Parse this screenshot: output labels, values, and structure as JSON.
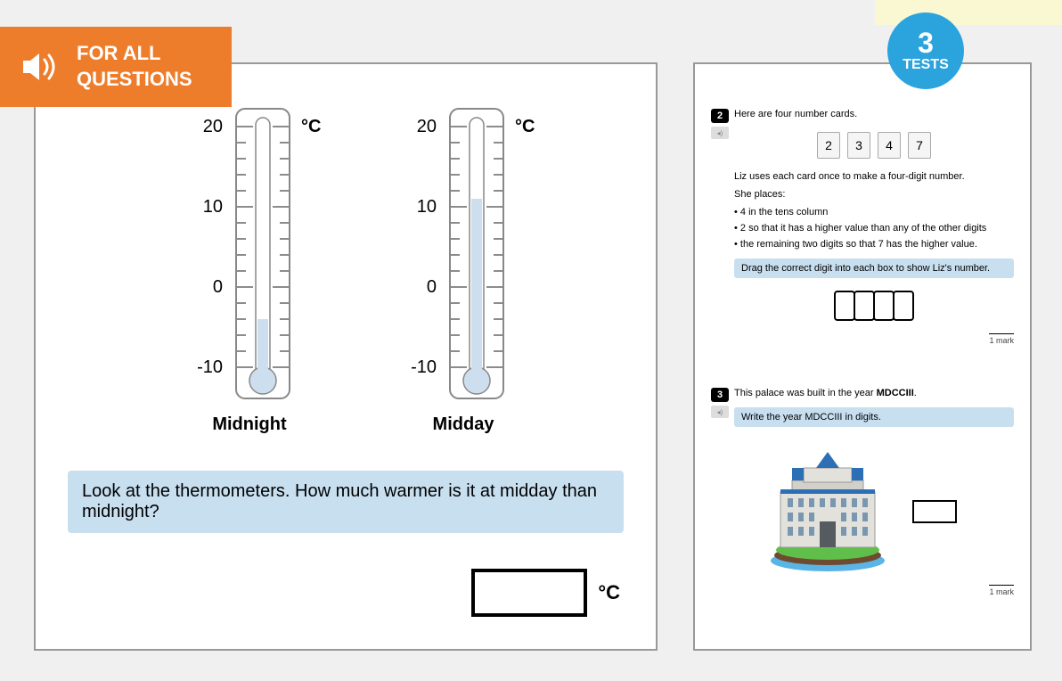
{
  "banner": {
    "line1": "FOR ALL",
    "line2": "QUESTIONS"
  },
  "badge": {
    "number": "3",
    "label": "TESTS"
  },
  "left": {
    "thermo1_label": "Midnight",
    "thermo2_label": "Midday",
    "unit_label": "°C",
    "ticks": {
      "t20": "20",
      "t10": "10",
      "t0": "0",
      "tm10": "-10"
    },
    "question": "Look at the thermometers. How much warmer is it at midday than midnight?",
    "answer_unit": "°C"
  },
  "chart_data": [
    {
      "type": "bar",
      "title": "Thermometer readings",
      "ylabel": "°C",
      "ylim": [
        -15,
        25
      ],
      "categories": [
        "Midnight",
        "Midday"
      ],
      "values": [
        -4,
        11
      ]
    }
  ],
  "right": {
    "q2": {
      "number": "2",
      "intro": "Here are four number cards.",
      "cards": [
        "2",
        "3",
        "4",
        "7"
      ],
      "p1": "Liz uses each card once to make a four-digit number.",
      "p2": "She places:",
      "b1": "• 4 in the tens column",
      "b2": "• 2 so that it has a higher value than any of the other digits",
      "b3": "• the remaining two digits so that 7 has the higher value.",
      "instruction": "Drag the correct digit into each box to show Liz's number.",
      "mark": "1 mark"
    },
    "q3": {
      "number": "3",
      "intro_prefix": "This palace was built in the year ",
      "intro_bold": "MDCCIII",
      "intro_suffix": ".",
      "instruction": "Write the year MDCCIII in digits.",
      "mark": "1 mark"
    }
  }
}
